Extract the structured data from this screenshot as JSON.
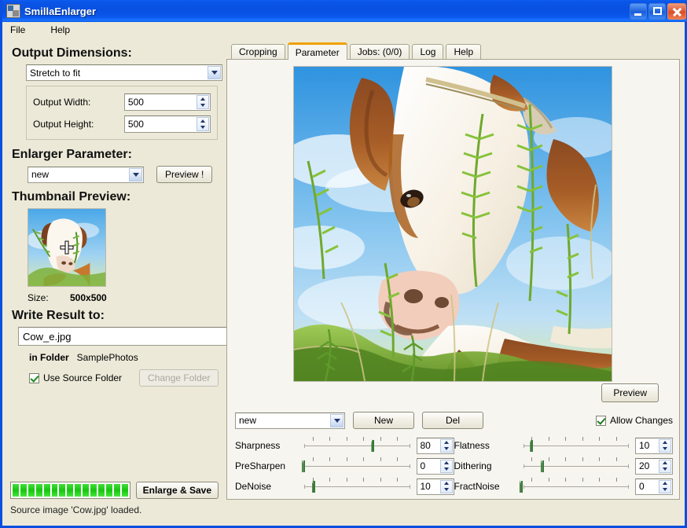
{
  "window": {
    "title": "SmillaEnlarger",
    "icon": "app-icon",
    "buttons": {
      "minimize": "minimize",
      "maximize": "maximize",
      "close": "close"
    }
  },
  "menu": {
    "items": [
      "File",
      "Help"
    ]
  },
  "left": {
    "output_dimensions": {
      "heading": "Output Dimensions:",
      "mode": "Stretch to fit",
      "fields": [
        {
          "label": "Output Width:",
          "value": "500"
        },
        {
          "label": "Output Height:",
          "value": "500"
        }
      ]
    },
    "enlarger_parameter": {
      "heading": "Enlarger Parameter:",
      "preset": "new",
      "preview_button": "Preview !"
    },
    "thumbnail": {
      "heading": "Thumbnail Preview:",
      "cursor_icon": "crosshair-icon",
      "size_label": "Size:",
      "size_value": "500x500"
    },
    "write_result": {
      "heading": "Write Result to:",
      "filename": "Cow_e.jpg",
      "folder_label": "in Folder",
      "folder_value": "SamplePhotos",
      "use_source_folder_label": "Use Source Folder",
      "use_source_folder_checked": true,
      "change_folder_button": "Change Folder",
      "change_folder_enabled": false
    },
    "bottom": {
      "progress_percent": 100,
      "progress_segments": 15,
      "enlarge_button": "Enlarge & Save",
      "status": "Source image 'Cow.jpg' loaded."
    }
  },
  "right": {
    "tabs": [
      {
        "label": "Cropping",
        "active": false
      },
      {
        "label": "Parameter",
        "active": true
      },
      {
        "label": "Jobs: (0/0)",
        "active": false
      },
      {
        "label": "Log",
        "active": false
      },
      {
        "label": "Help",
        "active": false
      }
    ],
    "image": {
      "alt": "close-up photo of a brown and white cow in grass under blue sky"
    },
    "preview_button": "Preview",
    "controls": {
      "preset": "new",
      "new_button": "New",
      "del_button": "Del",
      "allow_changes_label": "Allow Changes",
      "allow_changes_checked": true,
      "sliders_left": [
        {
          "name": "Sharpness",
          "value": "80",
          "pos": 68
        },
        {
          "name": "PreSharpen",
          "value": "0",
          "pos": 2
        },
        {
          "name": "DeNoise",
          "value": "10",
          "pos": 12
        }
      ],
      "sliders_right": [
        {
          "name": "Flatness",
          "value": "10",
          "pos": 11
        },
        {
          "name": "Dithering",
          "value": "20",
          "pos": 21
        },
        {
          "name": "FractNoise",
          "value": "0",
          "pos": 1
        }
      ]
    }
  },
  "colors": {
    "accent_tab": "#f0a000",
    "panel": "#ece9d8",
    "tab_panel": "#f6f5f0",
    "progress": "#16c40f",
    "title_blue": "#0850e0"
  }
}
